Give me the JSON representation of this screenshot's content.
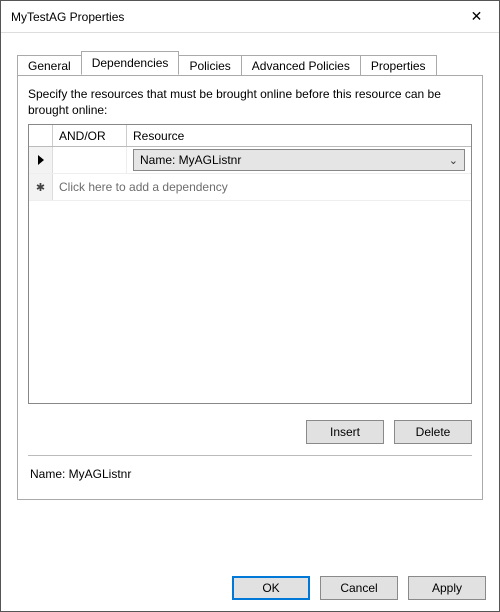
{
  "window": {
    "title": "MyTestAG Properties",
    "close_label": "✕"
  },
  "tabs": {
    "general": "General",
    "dependencies": "Dependencies",
    "policies": "Policies",
    "advanced_policies": "Advanced Policies",
    "properties": "Properties",
    "active": "dependencies"
  },
  "panel": {
    "instruction": "Specify the resources that must be brought online before this resource can be brought online:",
    "headers": {
      "andor": "AND/OR",
      "resource": "Resource"
    },
    "rows": [
      {
        "andor": "",
        "resource": "Name: MyAGListnr"
      }
    ],
    "placeholder": "Click here to add a dependency",
    "buttons": {
      "insert": "Insert",
      "delete": "Delete"
    },
    "detail": "Name: MyAGListnr"
  },
  "dialog_buttons": {
    "ok": "OK",
    "cancel": "Cancel",
    "apply": "Apply"
  }
}
